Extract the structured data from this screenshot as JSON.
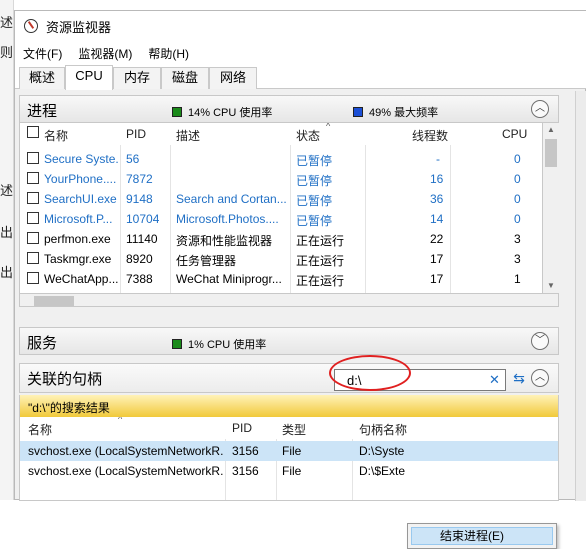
{
  "background": {
    "fragments": [
      "述",
      "则",
      "述",
      "出",
      "出"
    ]
  },
  "window": {
    "title": "资源监视器"
  },
  "menu": [
    "文件(F)",
    "监视器(M)",
    "帮助(H)"
  ],
  "tabs": [
    "概述",
    "CPU",
    "内存",
    "磁盘",
    "网络"
  ],
  "active_tab": "CPU",
  "processes": {
    "title": "进程",
    "cpu_usage": "14% CPU 使用率",
    "max_freq": "49% 最大频率",
    "columns": [
      "名称",
      "PID",
      "描述",
      "状态",
      "线程数",
      "CPU"
    ],
    "rows": [
      {
        "name": "Secure Syste...",
        "pid": "56",
        "desc": "",
        "status": "已暂停",
        "threads": "-",
        "cpu": "0",
        "suspended": true
      },
      {
        "name": "YourPhone....",
        "pid": "7872",
        "desc": "",
        "status": "已暂停",
        "threads": "16",
        "cpu": "0",
        "suspended": true
      },
      {
        "name": "SearchUI.exe",
        "pid": "9148",
        "desc": "Search and Cortan...",
        "status": "已暂停",
        "threads": "36",
        "cpu": "0",
        "suspended": true
      },
      {
        "name": "Microsoft.P...",
        "pid": "10704",
        "desc": "Microsoft.Photos....",
        "status": "已暂停",
        "threads": "14",
        "cpu": "0",
        "suspended": true
      },
      {
        "name": "perfmon.exe",
        "pid": "11140",
        "desc": "资源和性能监视器",
        "status": "正在运行",
        "threads": "22",
        "cpu": "3",
        "suspended": false
      },
      {
        "name": "Taskmgr.exe",
        "pid": "8920",
        "desc": "任务管理器",
        "status": "正在运行",
        "threads": "17",
        "cpu": "3",
        "suspended": false
      },
      {
        "name": "WeChatApp...",
        "pid": "7388",
        "desc": "WeChat Miniprogr...",
        "status": "正在运行",
        "threads": "17",
        "cpu": "1",
        "suspended": false
      }
    ]
  },
  "services": {
    "title": "服务",
    "cpu_usage": "1% CPU 使用率"
  },
  "handles": {
    "title": "关联的句柄",
    "search_value": "d:\\",
    "results_label": "\"d:\\\"的搜索结果",
    "columns": [
      "名称",
      "PID",
      "类型",
      "句柄名称"
    ],
    "rows": [
      {
        "name": "svchost.exe (LocalSystemNetworkR...",
        "pid": "3156",
        "type": "File",
        "handle": "D:\\Syste"
      },
      {
        "name": "svchost.exe (LocalSystemNetworkR...",
        "pid": "3156",
        "type": "File",
        "handle": "D:\\$Exte"
      }
    ]
  },
  "context_menu": {
    "item": "结束进程(E)"
  },
  "colors": {
    "cpu_indicator": "#1a8a1a",
    "freq_indicator": "#1b4fd6",
    "suspended_text": "#1f6fc5",
    "highlight": "#f1c93a",
    "annotation": "#e02020"
  }
}
